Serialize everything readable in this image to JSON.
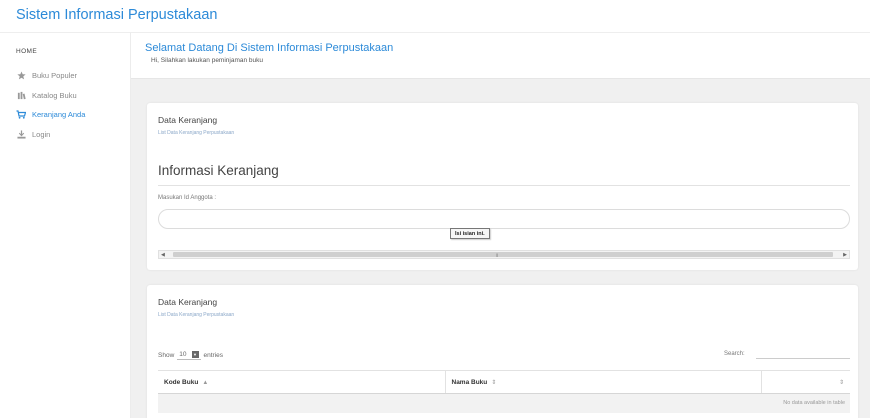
{
  "header": {
    "brand": "Sistem Informasi Perpustakaan"
  },
  "sidebar": {
    "heading": "HOME",
    "items": [
      {
        "label": "Buku Populer",
        "icon": "star-icon"
      },
      {
        "label": "Katalog Buku",
        "icon": "book-icon"
      },
      {
        "label": "Keranjang Anda",
        "icon": "cart-icon",
        "active": true
      },
      {
        "label": "Login",
        "icon": "login-icon"
      }
    ]
  },
  "welcome": {
    "title": "Selamat Datang Di Sistem Informasi Perpustakaan",
    "subtitle": "Hi, Silahkan lakukan peminjaman buku"
  },
  "cart_form": {
    "title": "Data Keranjang",
    "subtitle": "List Data Keranjang Perpustakaan",
    "section_title": "Informasi Keranjang",
    "field_label": "Masukan Id Anggota :",
    "field_value": "",
    "field_placeholder": "",
    "validation_tooltip": "Isi isian ini."
  },
  "cart_table": {
    "title": "Data Keranjang",
    "subtitle": "List Data Keranjang Perpustakaan",
    "show_label": "Show",
    "entries_value": "10",
    "entries_label": "entries",
    "search_label": "Search:",
    "columns": [
      {
        "label": "Kode Buku",
        "sort": "▲"
      },
      {
        "label": "Nama Buku",
        "sort": "⇕"
      },
      {
        "label": "",
        "sort": "⇕"
      }
    ],
    "empty_message": "No data available in table"
  },
  "colors": {
    "accent": "#2c8ad8",
    "background": "#f0f0f0"
  }
}
